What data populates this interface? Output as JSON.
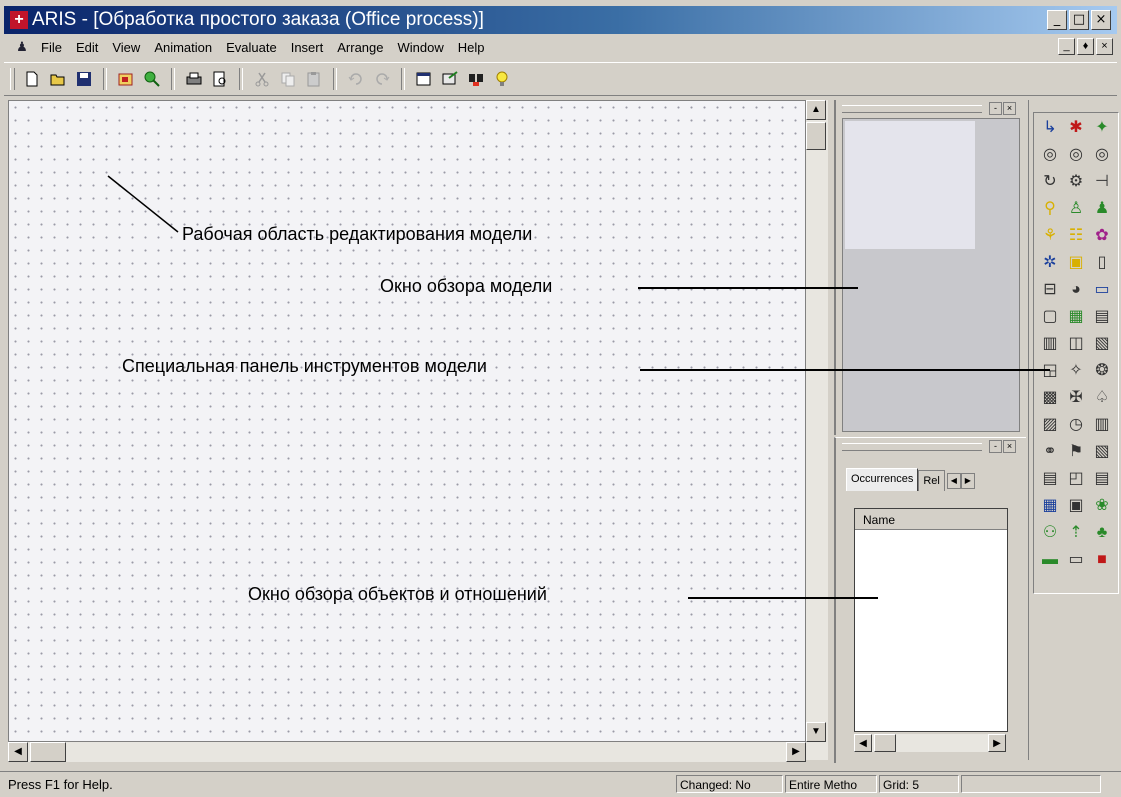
{
  "window": {
    "title": "ARIS - [Обработка простого заказа (Office process)]",
    "controls": [
      "_",
      "□",
      "×"
    ],
    "mdi_controls": [
      "_",
      "♦",
      "×"
    ]
  },
  "menubar": {
    "items": [
      "File",
      "Edit",
      "View",
      "Animation",
      "Evaluate",
      "Insert",
      "Arrange",
      "Window",
      "Help"
    ]
  },
  "toolbar": {
    "groups": [
      [
        "new-icon",
        "open-icon",
        "save-icon"
      ],
      [
        "model-icon",
        "search-icon"
      ],
      [
        "print-icon",
        "print-preview-icon"
      ],
      [
        "cut-icon",
        "copy-icon",
        "paste-icon"
      ],
      [
        "undo-icon",
        "redo-icon"
      ],
      [
        "properties-icon",
        "evaluate-icon",
        "find-icon",
        "tip-icon"
      ]
    ]
  },
  "overview_panel": {
    "buttons": [
      "-",
      "×"
    ]
  },
  "objects_panel": {
    "buttons": [
      "-",
      "×"
    ],
    "tabs": [
      "Occurrences",
      "Rel"
    ],
    "list_header": "Name"
  },
  "palette": {
    "icons": [
      "connection-icon",
      "object-icon",
      "function-icon",
      "event-icon",
      "rule-icon",
      "xor-icon",
      "process-icon",
      "org-icon",
      "role-icon",
      "person-icon",
      "group-icon",
      "position-icon",
      "entity-icon",
      "data-icon",
      "cluster-icon",
      "product-icon",
      "info-icon",
      "document-icon",
      "system-icon",
      "comment-icon",
      "message-icon",
      "folder-icon",
      "database-icon",
      "file-icon",
      "module-icon",
      "list-icon",
      "app-icon",
      "screen-icon",
      "goal-icon",
      "settings-icon",
      "service-icon",
      "flow-icon",
      "card-icon",
      "form-icon",
      "timer-icon",
      "report-icon",
      "network-icon",
      "location-icon",
      "table-icon",
      "book-icon",
      "archive-icon",
      "board-icon",
      "printer-icon",
      "box-icon",
      "tree-icon",
      "user-icon",
      "arrow-icon",
      "plant-icon",
      "cash-icon",
      "frame-icon",
      "red-box-icon"
    ],
    "colors": {
      "green": "#2a8a2a",
      "red": "#c01818",
      "yellow": "#d8b000",
      "blue": "#1a3f9c",
      "magenta": "#a0208a"
    }
  },
  "statusbar": {
    "help": "Press F1 for Help.",
    "changed": "Changed: No",
    "method": "Entire Metho",
    "grid": "Grid: 5"
  },
  "annotations": {
    "workspace": "Рабочая область редактирования модели",
    "overview": "Окно обзора модели",
    "toolbar": "Специальная панель инструментов модели",
    "objects": "Окно обзора объектов и отношений"
  }
}
